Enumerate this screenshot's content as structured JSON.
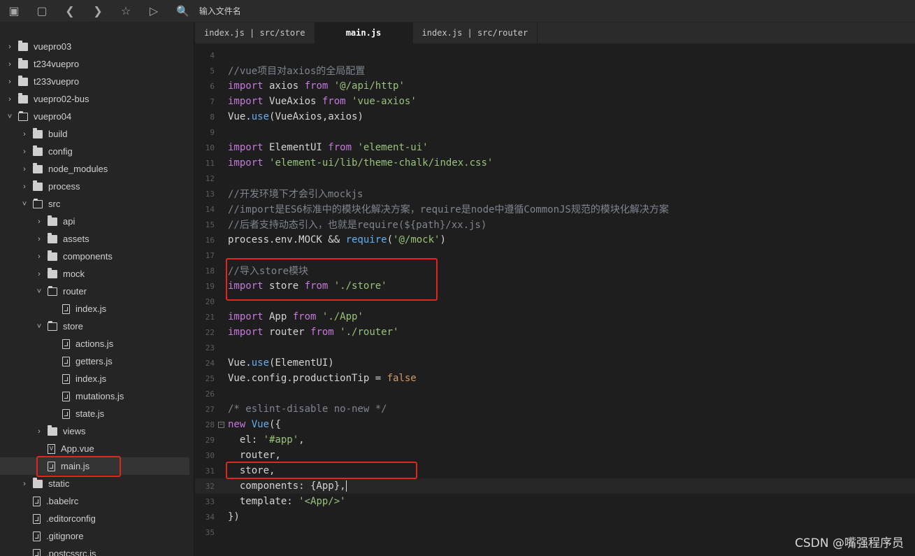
{
  "toolbar": {
    "buttons": [
      "new-file-icon",
      "save-icon",
      "back-icon",
      "forward-icon",
      "star-icon",
      "run-icon"
    ],
    "search_placeholder": "输入文件名"
  },
  "sidebar": {
    "items": [
      {
        "label": "vuepro03",
        "level": 0,
        "kind": "folder",
        "open": false
      },
      {
        "label": "t234vuepro",
        "level": 0,
        "kind": "folder",
        "open": false
      },
      {
        "label": "t233vuepro",
        "level": 0,
        "kind": "folder",
        "open": false
      },
      {
        "label": "vuepro02-bus",
        "level": 0,
        "kind": "folder",
        "open": false
      },
      {
        "label": "vuepro04",
        "level": 0,
        "kind": "folder",
        "open": true
      },
      {
        "label": "build",
        "level": 1,
        "kind": "folder",
        "open": false
      },
      {
        "label": "config",
        "level": 1,
        "kind": "folder",
        "open": false
      },
      {
        "label": "node_modules",
        "level": 1,
        "kind": "folder",
        "open": false
      },
      {
        "label": "process",
        "level": 1,
        "kind": "folder",
        "open": false
      },
      {
        "label": "src",
        "level": 1,
        "kind": "folder",
        "open": true
      },
      {
        "label": "api",
        "level": 2,
        "kind": "folder",
        "open": false
      },
      {
        "label": "assets",
        "level": 2,
        "kind": "folder",
        "open": false
      },
      {
        "label": "components",
        "level": 2,
        "kind": "folder",
        "open": false
      },
      {
        "label": "mock",
        "level": 2,
        "kind": "folder",
        "open": false
      },
      {
        "label": "router",
        "level": 2,
        "kind": "folder",
        "open": true
      },
      {
        "label": "index.js",
        "level": 3,
        "kind": "file"
      },
      {
        "label": "store",
        "level": 2,
        "kind": "folder",
        "open": true
      },
      {
        "label": "actions.js",
        "level": 3,
        "kind": "file"
      },
      {
        "label": "getters.js",
        "level": 3,
        "kind": "file"
      },
      {
        "label": "index.js",
        "level": 3,
        "kind": "file"
      },
      {
        "label": "mutations.js",
        "level": 3,
        "kind": "file"
      },
      {
        "label": "state.js",
        "level": 3,
        "kind": "file"
      },
      {
        "label": "views",
        "level": 2,
        "kind": "folder",
        "open": false
      },
      {
        "label": "App.vue",
        "level": 2,
        "kind": "vue"
      },
      {
        "label": "main.js",
        "level": 2,
        "kind": "file",
        "selected": true
      },
      {
        "label": "static",
        "level": 1,
        "kind": "folder",
        "open": false
      },
      {
        "label": ".babelrc",
        "level": 1,
        "kind": "file"
      },
      {
        "label": ".editorconfig",
        "level": 1,
        "kind": "file"
      },
      {
        "label": ".gitignore",
        "level": 1,
        "kind": "file"
      },
      {
        "label": ".postcssrc.js",
        "level": 1,
        "kind": "file"
      }
    ]
  },
  "tabs": [
    {
      "label": "index.js | src/store",
      "active": false
    },
    {
      "label": "main.js",
      "active": true
    },
    {
      "label": "index.js | src/router",
      "active": false
    }
  ],
  "editor": {
    "lines": [
      {
        "n": "4",
        "tokens": []
      },
      {
        "n": "5",
        "tokens": [
          [
            "c",
            "//vue项目对axios的全局配置"
          ]
        ]
      },
      {
        "n": "6",
        "tokens": [
          [
            "k",
            "import"
          ],
          [
            "",
            " axios "
          ],
          [
            "k",
            "from"
          ],
          [
            "",
            " "
          ],
          [
            "s",
            "'@/api/http'"
          ]
        ]
      },
      {
        "n": "7",
        "tokens": [
          [
            "k",
            "import"
          ],
          [
            "",
            " VueAxios "
          ],
          [
            "k",
            "from"
          ],
          [
            "",
            " "
          ],
          [
            "s",
            "'vue-axios'"
          ]
        ]
      },
      {
        "n": "8",
        "tokens": [
          [
            "",
            "Vue."
          ],
          [
            "f",
            "use"
          ],
          [
            "",
            "(VueAxios,axios)"
          ]
        ]
      },
      {
        "n": "9",
        "tokens": []
      },
      {
        "n": "10",
        "tokens": [
          [
            "k",
            "import"
          ],
          [
            "",
            " ElementUI "
          ],
          [
            "k",
            "from"
          ],
          [
            "",
            " "
          ],
          [
            "s",
            "'element-ui'"
          ]
        ]
      },
      {
        "n": "11",
        "tokens": [
          [
            "k",
            "import"
          ],
          [
            "",
            " "
          ],
          [
            "s",
            "'element-ui/lib/theme-chalk/index.css'"
          ]
        ]
      },
      {
        "n": "12",
        "tokens": []
      },
      {
        "n": "13",
        "tokens": [
          [
            "c",
            "//开发环境下才会引入mockjs"
          ]
        ]
      },
      {
        "n": "14",
        "tokens": [
          [
            "c",
            "//import是ES6标准中的模块化解决方案，require是node中遵循CommonJS规范的模块化解决方案"
          ]
        ]
      },
      {
        "n": "15",
        "tokens": [
          [
            "c",
            "//后者支持动态引入，也就是require(${path}/xx.js)"
          ]
        ]
      },
      {
        "n": "16",
        "tokens": [
          [
            "",
            "process.env.MOCK && "
          ],
          [
            "f",
            "require"
          ],
          [
            "",
            "("
          ],
          [
            "s",
            "'@/mock'"
          ],
          [
            "",
            ")"
          ]
        ]
      },
      {
        "n": "17",
        "tokens": []
      },
      {
        "n": "18",
        "tokens": [
          [
            "c",
            "//导入store模块"
          ]
        ]
      },
      {
        "n": "19",
        "tokens": [
          [
            "k",
            "import"
          ],
          [
            "",
            " store "
          ],
          [
            "k",
            "from"
          ],
          [
            "",
            " "
          ],
          [
            "s",
            "'./store'"
          ]
        ]
      },
      {
        "n": "20",
        "tokens": []
      },
      {
        "n": "21",
        "tokens": [
          [
            "k",
            "import"
          ],
          [
            "",
            " App "
          ],
          [
            "k",
            "from"
          ],
          [
            "",
            " "
          ],
          [
            "s",
            "'./App'"
          ]
        ]
      },
      {
        "n": "22",
        "tokens": [
          [
            "k",
            "import"
          ],
          [
            "",
            " router "
          ],
          [
            "k",
            "from"
          ],
          [
            "",
            " "
          ],
          [
            "s",
            "'./router'"
          ]
        ]
      },
      {
        "n": "23",
        "tokens": []
      },
      {
        "n": "24",
        "tokens": [
          [
            "",
            "Vue."
          ],
          [
            "f",
            "use"
          ],
          [
            "",
            "(ElementUI)"
          ]
        ]
      },
      {
        "n": "25",
        "tokens": [
          [
            "",
            "Vue.config.productionTip = "
          ],
          [
            "fl",
            "false"
          ]
        ]
      },
      {
        "n": "26",
        "tokens": []
      },
      {
        "n": "27",
        "tokens": [
          [
            "c",
            "/* eslint-disable no-new */"
          ]
        ]
      },
      {
        "n": "28",
        "tokens": [
          [
            "k",
            "new"
          ],
          [
            "",
            " "
          ],
          [
            "f",
            "Vue"
          ],
          [
            "",
            "({"
          ]
        ],
        "fold": true
      },
      {
        "n": "29",
        "tokens": [
          [
            "",
            "  el: "
          ],
          [
            "s",
            "'#app'"
          ],
          [
            "",
            ","
          ]
        ]
      },
      {
        "n": "30",
        "tokens": [
          [
            "",
            "  router,"
          ]
        ]
      },
      {
        "n": "31",
        "tokens": [
          [
            "",
            "  store,"
          ]
        ]
      },
      {
        "n": "32",
        "tokens": [
          [
            "",
            "  components: {App},"
          ]
        ],
        "current": true
      },
      {
        "n": "33",
        "tokens": [
          [
            "",
            "  template: "
          ],
          [
            "s",
            "'<App/>'"
          ]
        ]
      },
      {
        "n": "34",
        "tokens": [
          [
            "",
            "})"
          ]
        ]
      },
      {
        "n": "35",
        "tokens": []
      }
    ]
  },
  "watermark": "CSDN @嘴强程序员",
  "colors": {
    "highlight_box": "#e0261f",
    "keyword": "#c678dd",
    "string": "#98c379",
    "comment": "#7f848e",
    "function": "#61afef"
  }
}
